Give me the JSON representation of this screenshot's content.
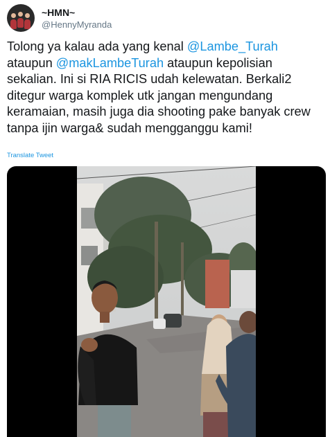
{
  "user": {
    "display_name": "~HMN~",
    "handle": "@HennyMyranda"
  },
  "tweet": {
    "line1_pre": "Tolong ya kalau ada yang kenal ",
    "mention1": "@Lambe_Turah",
    "line2_pre": "ataupun ",
    "mention2": "@makLambeTurah",
    "line2_post": " ataupun kepolisian",
    "rest": "sekalian. Ini si RIA RICIS udah kelewatan. Berkali2\nditegur warga komplek utk jangan mengundang\nkeramaian, masih juga dia shooting pake banyak crew\ntanpa ijin warga& sudah mengganggu kami!"
  },
  "translate_label": "Translate Tweet",
  "colors": {
    "link": "#1b95e0",
    "text": "#14171a",
    "secondary": "#657786"
  },
  "media": {
    "type": "video-still",
    "icon": "video-frame"
  }
}
